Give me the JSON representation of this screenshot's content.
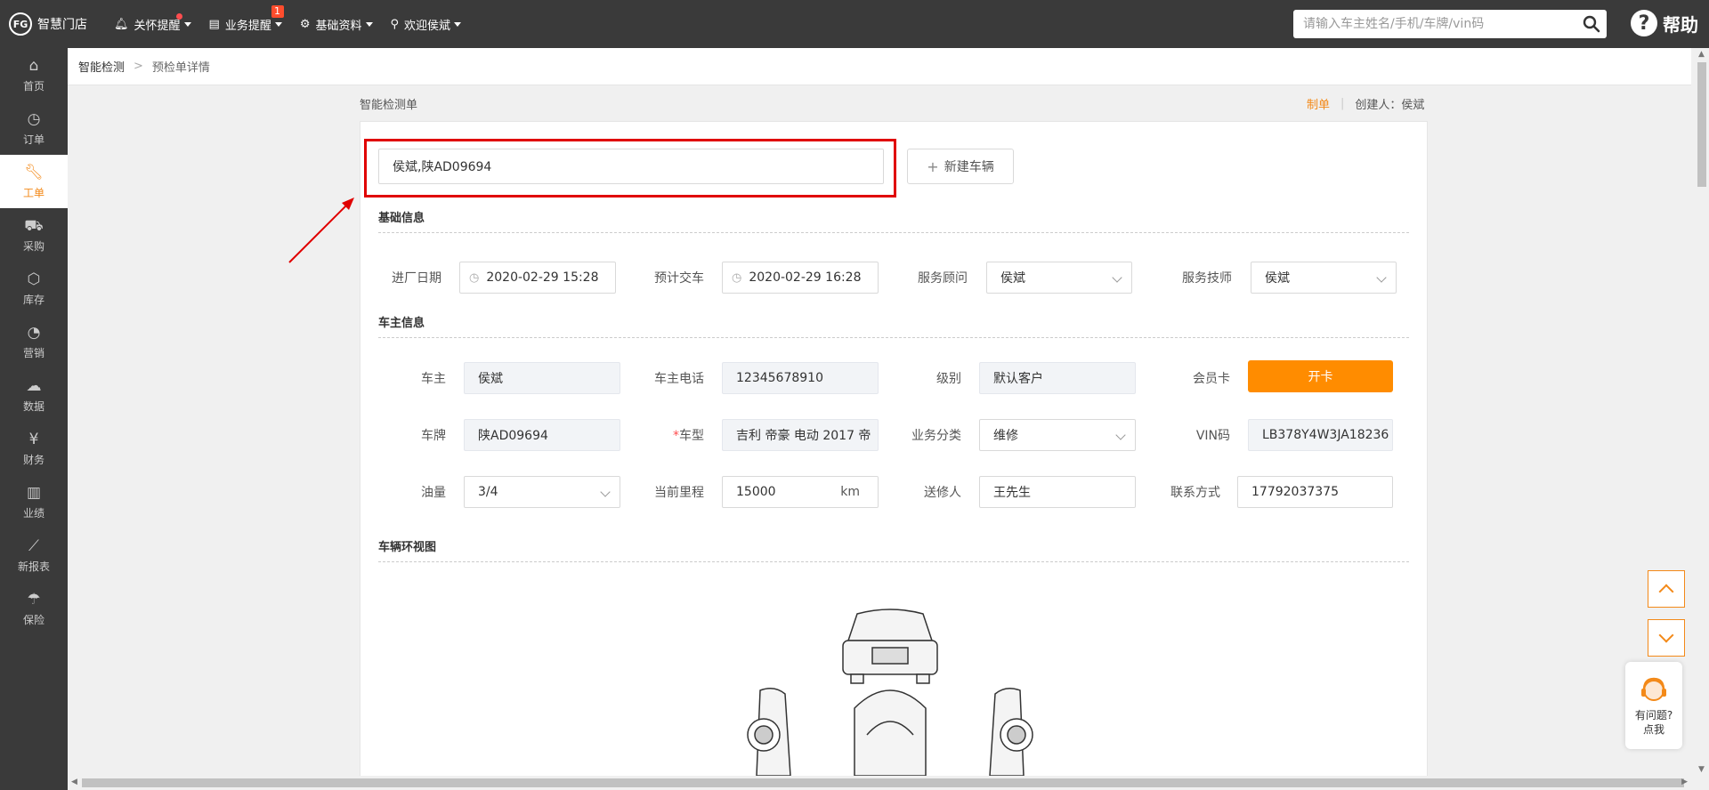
{
  "topbar": {
    "logo_text": "智慧门店",
    "logo_mark": "FG",
    "nav": [
      {
        "label": "关怀提醒",
        "icon": "bell-icon",
        "glyph": "🔔︎"
      },
      {
        "label": "业务提醒",
        "icon": "document-icon",
        "glyph": "▤",
        "badge": "1"
      },
      {
        "label": "基础资料",
        "icon": "gear-icon",
        "glyph": "⚙"
      },
      {
        "label": "欢迎侯斌",
        "icon": "user-icon",
        "glyph": "⚲"
      }
    ],
    "search_placeholder": "请输入车主姓名/手机/车牌/vin码",
    "help_label": "帮助"
  },
  "sidebar": {
    "items": [
      {
        "label": "首页",
        "glyph": "⌂",
        "icon": "home-icon"
      },
      {
        "label": "订单",
        "glyph": "◷",
        "icon": "history-icon"
      },
      {
        "label": "工单",
        "glyph": "🔧︎",
        "icon": "wrench-icon",
        "active": true
      },
      {
        "label": "采购",
        "glyph": "⛟",
        "icon": "cart-icon"
      },
      {
        "label": "库存",
        "glyph": "⬡",
        "icon": "box-icon"
      },
      {
        "label": "营销",
        "glyph": "◔",
        "icon": "pie-icon"
      },
      {
        "label": "数据",
        "glyph": "☁",
        "icon": "cloud-icon"
      },
      {
        "label": "财务",
        "glyph": "¥",
        "icon": "yen-icon"
      },
      {
        "label": "业绩",
        "glyph": "▥",
        "icon": "bar-chart-icon"
      },
      {
        "label": "新报表",
        "glyph": "⟋",
        "icon": "line-chart-icon"
      },
      {
        "label": "保险",
        "glyph": "☂",
        "icon": "umbrella-icon"
      }
    ]
  },
  "breadcrumb": {
    "root": "智能检测",
    "current": "预检单详情"
  },
  "form": {
    "title": "智能检测单",
    "status": "制单",
    "creator": "创建人：侯斌",
    "owner_search_value": "侯斌,陕AD09694",
    "new_vehicle_label": "新建车辆",
    "sections": {
      "basic": "基础信息",
      "owner": "车主信息",
      "view": "车辆环视图"
    },
    "basic": {
      "entry_date_label": "进厂日期",
      "entry_date": "2020-02-29 15:28",
      "delivery_label": "预计交车",
      "delivery_date": "2020-02-29 16:28",
      "advisor_label": "服务顾问",
      "advisor": "侯斌",
      "technician_label": "服务技师",
      "technician": "侯斌"
    },
    "owner": {
      "owner_label": "车主",
      "owner": "侯斌",
      "phone_label": "车主电话",
      "phone": "12345678910",
      "level_label": "级别",
      "level": "默认客户",
      "card_label": "会员卡",
      "open_card": "开卡",
      "plate_label": "车牌",
      "plate": "陕AD09694",
      "model_required": "*",
      "model_label": "车型",
      "model": "吉利 帝豪 电动  2017 帝",
      "business_label": "业务分类",
      "business": "维修",
      "vin_label": "VIN码",
      "vin": "LB378Y4W3JA18236",
      "fuel_label": "油量",
      "fuel": "3/4",
      "mileage_label": "当前里程",
      "mileage": "15000",
      "mileage_unit": "km",
      "sender_label": "送修人",
      "sender": "王先生",
      "contact_label": "联系方式",
      "contact": "17792037375"
    }
  },
  "float": {
    "help_line1": "有问题?",
    "help_line2": "点我"
  },
  "colors": {
    "topbar": "#3a3a3a",
    "accent": "#f38918",
    "open_card": "#ff8c00",
    "highlight": "#e00000"
  }
}
